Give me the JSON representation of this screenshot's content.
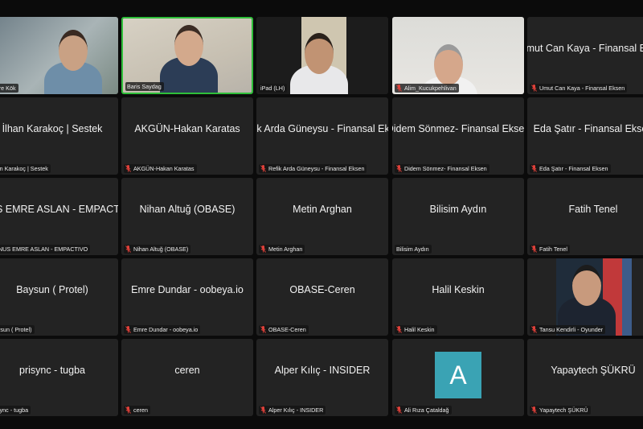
{
  "rows": [
    [
      {
        "name": "Emre Kök",
        "label": "Emre Kök",
        "video": true,
        "muted": false
      },
      {
        "name": "Baris Saydag",
        "label": "Baris Saydag",
        "video": true,
        "muted": false,
        "active": true
      },
      {
        "name": "iPad (LH)",
        "label": "iPad (LH)",
        "video": true,
        "muted": false
      },
      {
        "name": "Alim_Kucukpehlivan",
        "label": "Alim_Kucukpehlivan",
        "video": true,
        "muted": true
      },
      {
        "name": "Umut Can Kaya - Finansal Eksen",
        "label": "Umut Can Kaya - Finansal Eksen",
        "video": false,
        "muted": true
      }
    ],
    [
      {
        "name": "İlhan Karakoç | Sestek",
        "label": "İlhan Karakoç | Sestek",
        "video": false,
        "muted": false
      },
      {
        "name": "AKGÜN-Hakan Karatas",
        "label": "AKGÜN-Hakan Karatas",
        "video": false,
        "muted": true
      },
      {
        "name": "Refik Arda Güneysu - Finansal Eksen",
        "label": "Refik Arda Güneysu - Finansal Eksen",
        "video": false,
        "muted": true
      },
      {
        "name": "Didem Sönmez- Finansal Eksen",
        "label": "Didem Sönmez- Finansal Eksen",
        "video": false,
        "muted": true
      },
      {
        "name": "Eda Şatır - Finansal Eksen",
        "label": "Eda Şatır - Finansal Eksen",
        "video": false,
        "muted": true
      }
    ],
    [
      {
        "name": "YUNUS EMRE ASLAN - EMPACTIVO",
        "label": "YUNUS EMRE ASLAN - EMPACTIVO",
        "video": false,
        "muted": false
      },
      {
        "name": "Nihan Altuğ (OBASE)",
        "label": "Nihan Altuğ (OBASE)",
        "video": false,
        "muted": true
      },
      {
        "name": "Metin Arghan",
        "label": "Metin Arghan",
        "video": false,
        "muted": true
      },
      {
        "name": "Bilisim Aydın",
        "label": "Bilisim Aydın",
        "video": false,
        "muted": false
      },
      {
        "name": "Fatih Tenel",
        "label": "Fatih Tenel",
        "video": false,
        "muted": true
      }
    ],
    [
      {
        "name": "Baysun ( Protel)",
        "label": "Baysun ( Protel)",
        "video": false,
        "muted": false
      },
      {
        "name": "Emre Dundar - oobeya.io",
        "label": "Emre Dundar - oobeya.io",
        "video": false,
        "muted": true
      },
      {
        "name": "OBASE-Ceren",
        "label": "OBASE-Ceren",
        "video": false,
        "muted": true
      },
      {
        "name": "Halil Keskin",
        "label": "Halil Keskin",
        "video": false,
        "muted": true
      },
      {
        "name": "Tansu Kendirli - Oyunder",
        "label": "Tansu Kendirli - Oyunder",
        "video": true,
        "muted": true
      }
    ],
    [
      {
        "name": "prisync - tugba",
        "label": "prisync - tugba",
        "video": false,
        "muted": false
      },
      {
        "name": "ceren",
        "label": "ceren",
        "video": false,
        "muted": true
      },
      {
        "name": "Alper Kılıç - INSIDER",
        "label": "Alper Kılıç - INSIDER",
        "video": false,
        "muted": true
      },
      {
        "name": "Ali Rıza Çataldağ",
        "label": "Ali Rıza Çataldağ",
        "video": false,
        "muted": true,
        "avatar": "A"
      },
      {
        "name": "Yapaytech ŞÜKRÜ",
        "label": "Yapaytech ŞÜKRÜ",
        "video": false,
        "muted": true
      }
    ]
  ],
  "colors": {
    "muted_icon": "#e0413a",
    "active_border": "#2fbf3a",
    "avatar_bg": "#3aa3b4"
  }
}
